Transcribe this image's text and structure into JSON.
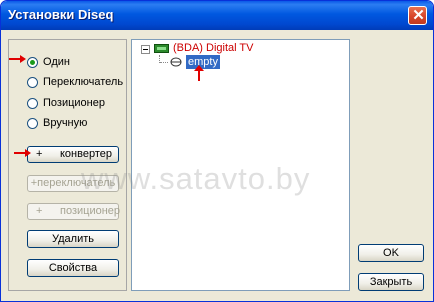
{
  "window": {
    "title": "Установки Diseq",
    "close_symbol": "✕"
  },
  "left_panel": {
    "radios": [
      {
        "label": "Один",
        "checked": true
      },
      {
        "label": "Переключатель",
        "checked": false
      },
      {
        "label": "Позиционер",
        "checked": false
      },
      {
        "label": "Вручную",
        "checked": false
      }
    ],
    "buttons": {
      "converter": {
        "plus": "+",
        "label": "конвертер"
      },
      "switch": {
        "label": "+переключатель",
        "disabled": true
      },
      "positioner": {
        "plus": "+",
        "label": "позиционер",
        "disabled": true
      },
      "delete": {
        "label": "Удалить"
      },
      "properties": {
        "label": "Свойства"
      }
    }
  },
  "tree": {
    "root": {
      "label": "(BDA) Digital TV",
      "icon": "tv-tuner-icon"
    },
    "child": {
      "label": "empty",
      "icon": "satellite-dish-icon",
      "selected": true
    }
  },
  "dialog_buttons": {
    "ok": "OK",
    "close": "Закрыть"
  },
  "watermark": "www.satavto.by",
  "colors": {
    "title_bar": "#0058e0",
    "accent_red": "#e00000",
    "selection": "#316ac5"
  }
}
